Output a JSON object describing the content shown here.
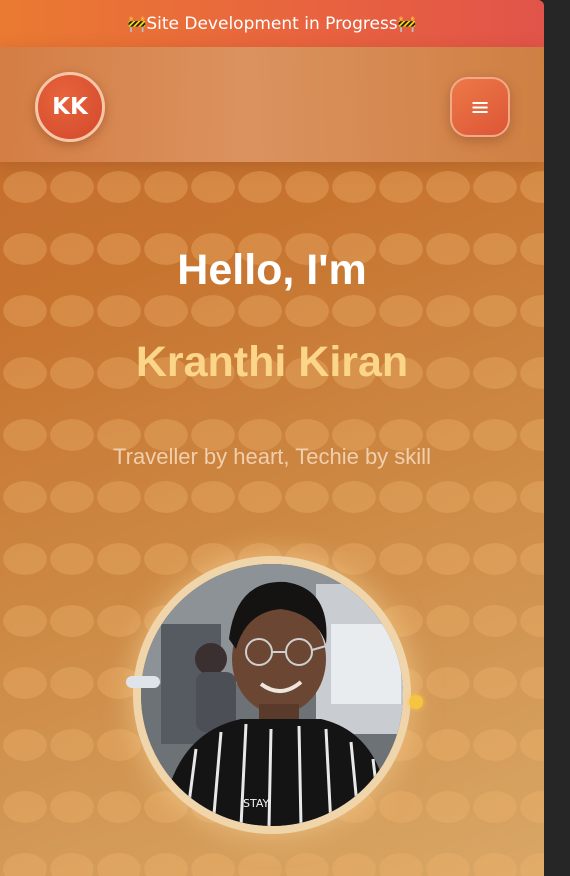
{
  "banner": {
    "text": "Site Development in Progress",
    "icon_left": "🚧",
    "icon_right": "🚧"
  },
  "nav": {
    "logo_text": "KK",
    "menu_icon": "≡"
  },
  "hero": {
    "greeting": "Hello, I'm",
    "name": "Kranthi Kiran",
    "tagline": "Traveller by heart, Techie by skill"
  },
  "photo": {
    "shirt_text": "STAY"
  },
  "colors": {
    "banner_start": "#ea7a32",
    "banner_end": "#e1544a",
    "name_accent": "#fbd58a",
    "logo_bg": "#d9532f",
    "orbit_dot": "#f5c441"
  }
}
